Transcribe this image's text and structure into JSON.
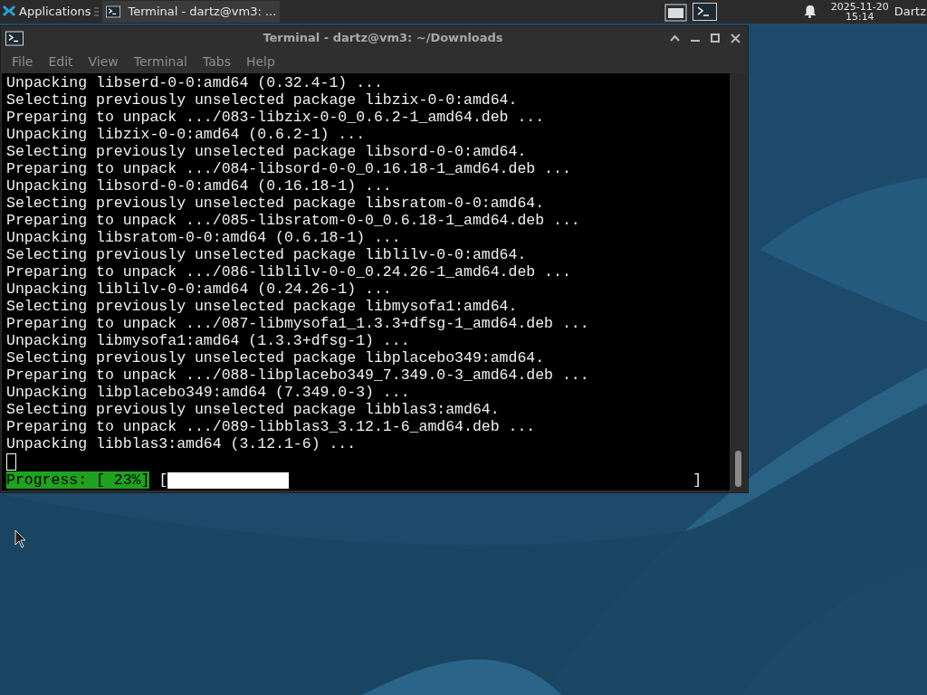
{
  "panel": {
    "menu_label": "Applications",
    "tasks": [
      {
        "label": "Terminal - dartz@vm3: ...",
        "selected": true
      }
    ],
    "clock": {
      "date": "2025-11-20",
      "time": "15:14"
    },
    "user": "Dartz"
  },
  "window": {
    "title": "Terminal - dartz@vm3: ~/Downloads",
    "menu": [
      "File",
      "Edit",
      "View",
      "Terminal",
      "Tabs",
      "Help"
    ],
    "lines": [
      "Unpacking libserd-0-0:amd64 (0.32.4-1) ...",
      "Selecting previously unselected package libzix-0-0:amd64.",
      "Preparing to unpack .../083-libzix-0-0_0.6.2-1_amd64.deb ...",
      "Unpacking libzix-0-0:amd64 (0.6.2-1) ...",
      "Selecting previously unselected package libsord-0-0:amd64.",
      "Preparing to unpack .../084-libsord-0-0_0.16.18-1_amd64.deb ...",
      "Unpacking libsord-0-0:amd64 (0.16.18-1) ...",
      "Selecting previously unselected package libsratom-0-0:amd64.",
      "Preparing to unpack .../085-libsratom-0-0_0.6.18-1_amd64.deb ...",
      "Unpacking libsratom-0-0:amd64 (0.6.18-1) ...",
      "Selecting previously unselected package liblilv-0-0:amd64.",
      "Preparing to unpack .../086-liblilv-0-0_0.24.26-1_amd64.deb ...",
      "Unpacking liblilv-0-0:amd64 (0.24.26-1) ...",
      "Selecting previously unselected package libmysofa1:amd64.",
      "Preparing to unpack .../087-libmysofa1_1.3.3+dfsg-1_amd64.deb ...",
      "Unpacking libmysofa1:amd64 (1.3.3+dfsg-1) ...",
      "Selecting previously unselected package libplacebo349:amd64.",
      "Preparing to unpack .../088-libplacebo349_7.349.0-3_amd64.deb ...",
      "Unpacking libplacebo349:amd64 (7.349.0-3) ...",
      "Selecting previously unselected package libblas3:amd64.",
      "Preparing to unpack .../089-libblas3_3.12.1-6_amd64.deb ...",
      "Unpacking libblas3:amd64 (3.12.1-6) ..."
    ],
    "progress": {
      "label": "Progress: [ 23%]",
      "open": "[",
      "close": "]",
      "level": 0.23
    }
  }
}
